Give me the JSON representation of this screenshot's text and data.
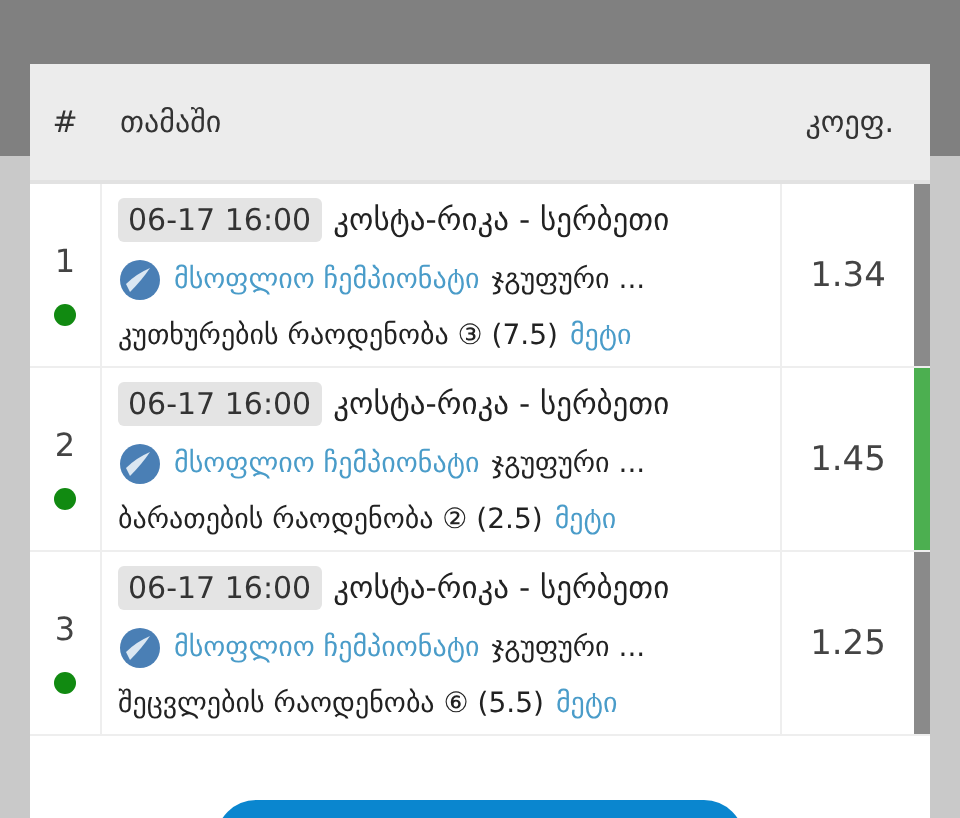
{
  "table": {
    "columns": [
      "#",
      "თამაში",
      "კოეფ."
    ],
    "rows": [
      {
        "number": "1",
        "time": "06-17 16:00",
        "match": "კოსტა-რიკა - სერბეთი",
        "league": "მსოფლიო ჩემპიონატი",
        "stage": "ჯგუფური ...",
        "market": "კუთხურების რაოდენობა ③ (7.5)",
        "more": "მეტი",
        "odds": "1.34",
        "color": "#8a8a8a"
      },
      {
        "number": "2",
        "time": "06-17 16:00",
        "match": "კოსტა-რიკა - სერბეთი",
        "league": "მსოფლიო ჩემპიონატი",
        "stage": "ჯგუფური ...",
        "market": "ბარათების რაოდენობა ② (2.5)",
        "more": "მეტი",
        "odds": "1.45",
        "color": "#4caf50"
      },
      {
        "number": "3",
        "time": "06-17 16:00",
        "match": "კოსტა-რიკა - სერბეთი",
        "league": "მსოფლიო ჩემპიონატი",
        "stage": "ჯგუფური ...",
        "market": "შეცვლების რაოდენობა ⑥ (5.5)",
        "more": "მეტი",
        "odds": "1.25",
        "color": "#8a8a8a"
      }
    ]
  }
}
